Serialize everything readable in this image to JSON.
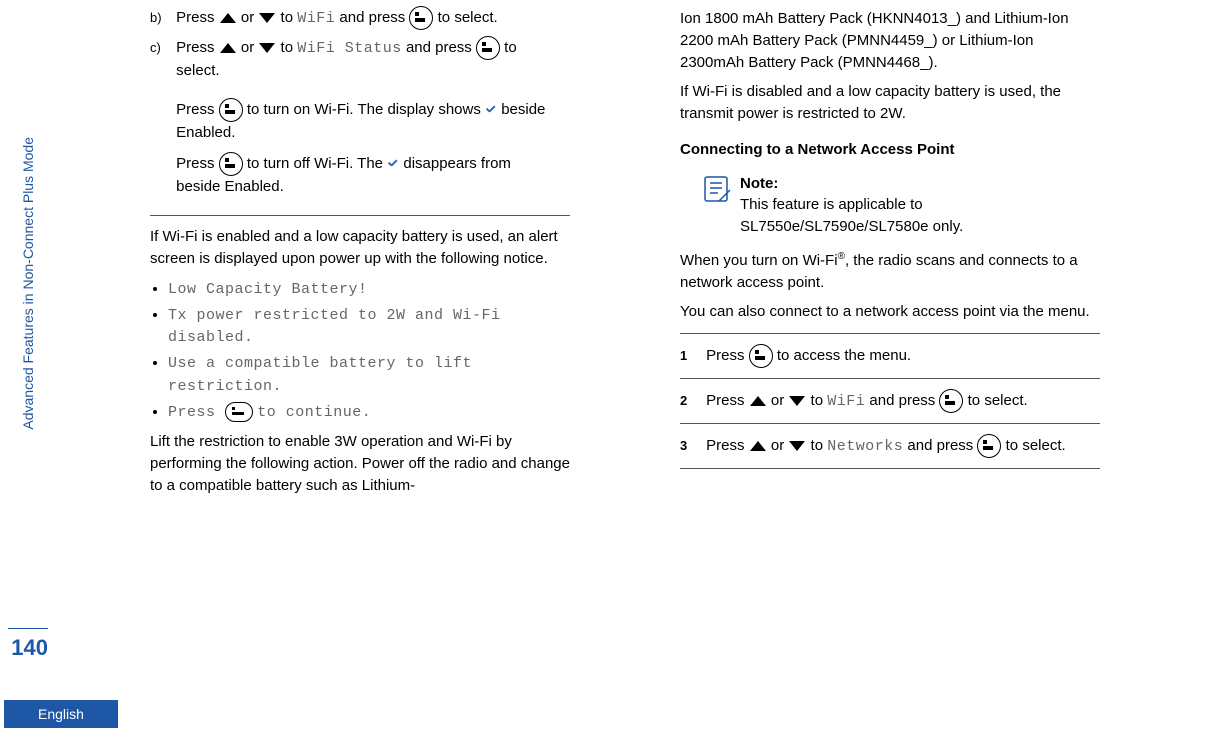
{
  "margin": {
    "chapter": "Advanced Features in Non-Connect Plus Mode",
    "page": "140",
    "lang": "English"
  },
  "col1": {
    "stepB": {
      "label": "b)",
      "pre": "Press ",
      "mid": " or ",
      "to": " to ",
      "wifi": "WiFi",
      "tail": " and press ",
      "fin": " to select."
    },
    "stepC": {
      "label": "c)",
      "pre": "Press ",
      "mid": " or ",
      "to": " to ",
      "ws": "WiFi Status",
      "tail": " and press ",
      "fin": " to select."
    },
    "on1a": "Press ",
    "on1b": " to turn on Wi-Fi. The display shows ",
    "on1c": " beside Enabled.",
    "off1a": "Press ",
    "off1b": " to turn off Wi-Fi. The ",
    "off1c": " disappears from beside Enabled.",
    "para1": "If Wi-Fi is enabled and a low capacity battery is used, an alert screen is displayed upon power up with the following notice.",
    "b1": "Low Capacity Battery!",
    "b2": "Tx power restricted to 2W and Wi-Fi disabled.",
    "b3": "Use a compatible battery to lift restriction.",
    "b4a": "Press ",
    "b4b": " to continue.",
    "para2": "Lift the restriction to enable 3W operation and Wi-Fi by performing the following action. Power off the radio and change to a compatible battery such as Lithium-"
  },
  "col2": {
    "top": "Ion 1800 mAh Battery Pack (HKNN4013_) and Lithium-Ion 2200 mAh Battery Pack (PMNN4459_) or Lithium-Ion 2300mAh Battery Pack (PMNN4468_).",
    "para3": "If Wi-Fi is disabled and a low capacity battery is used, the transmit power is restricted to 2W.",
    "head": "Connecting to a Network Access Point",
    "noteLabel": "Note:",
    "noteBody": "This feature is applicable to SL7550e/SL7590e/SL7580e only.",
    "para4a": "When you turn on Wi-Fi",
    "para4b": ", the radio scans and connects to a network access point.",
    "para5": "You can also connect to a network access point via the menu.",
    "n1": {
      "n": "1",
      "a": "Press ",
      "b": " to access the menu."
    },
    "n2": {
      "n": "2",
      "a": "Press ",
      "mid": " or ",
      "to": " to ",
      "wifi": "WiFi",
      "t": " and press ",
      "f": " to select."
    },
    "n3": {
      "n": "3",
      "a": "Press ",
      "mid": " or ",
      "to": " to ",
      "nw": "Networks",
      "t": " and press ",
      "f": " to select."
    }
  }
}
